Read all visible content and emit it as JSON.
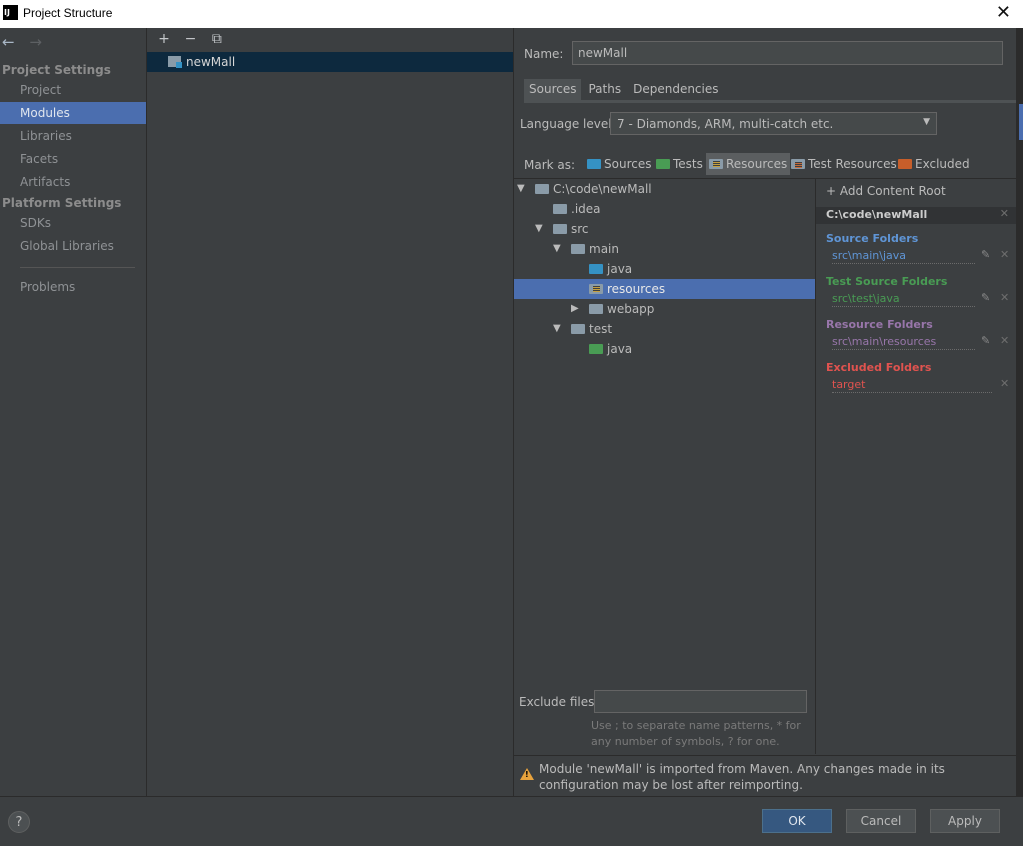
{
  "window": {
    "title": "Project Structure",
    "app_icon_text": "IJ",
    "close_glyph": "✕"
  },
  "nav": {
    "back": "←",
    "forward": "→"
  },
  "sidebar": {
    "project_settings_header": "Project Settings",
    "project_settings_items": [
      {
        "label": "Project"
      },
      {
        "label": "Modules",
        "selected": true
      },
      {
        "label": "Libraries"
      },
      {
        "label": "Facets"
      },
      {
        "label": "Artifacts"
      }
    ],
    "platform_settings_header": "Platform Settings",
    "platform_settings_items": [
      {
        "label": "SDKs"
      },
      {
        "label": "Global Libraries"
      }
    ],
    "problems": "Problems"
  },
  "modules_panel": {
    "toolbar": {
      "add": "+",
      "remove": "−",
      "copy": "⧉"
    },
    "module_name": "newMall"
  },
  "details": {
    "name_label": "Name:",
    "name_value": "newMall",
    "tabs": [
      "Sources",
      "Paths",
      "Dependencies"
    ],
    "selected_tab": "Sources",
    "language_level_label": "Language level:",
    "language_level_value": "7 - Diamonds, ARM, multi-catch etc.",
    "mark_as_label": "Mark as:",
    "mark_as_buttons": [
      "Sources",
      "Tests",
      "Resources",
      "Test Resources",
      "Excluded"
    ],
    "mark_as_selected": "Resources",
    "tree": [
      {
        "label": "C:\\code\\newMall",
        "expanded": true
      },
      {
        "label": ".idea"
      },
      {
        "label": "src",
        "expanded": true
      },
      {
        "label": "main",
        "expanded": true
      },
      {
        "label": "java"
      },
      {
        "label": "resources",
        "selected": true
      },
      {
        "label": "webapp",
        "expanded": false
      },
      {
        "label": "test",
        "expanded": true
      },
      {
        "label": "java"
      }
    ],
    "content_root": {
      "add_label": "+ Add Content Root",
      "root_path": "C:\\code\\newMall",
      "source_folders_title": "Source Folders",
      "source_folders_path": "src\\main\\java",
      "test_source_folders_title": "Test Source Folders",
      "test_source_folders_path": "src\\test\\java",
      "resource_folders_title": "Resource Folders",
      "resource_folders_path": "src\\main\\resources",
      "excluded_folders_title": "Excluded Folders",
      "excluded_folders_path": "target",
      "colors": {
        "source": "#5f95d6",
        "test": "#499c54",
        "resource": "#9876aa",
        "excluded": "#e0534f"
      }
    },
    "exclude_files_label": "Exclude files:",
    "exclude_files_value": "",
    "exclude_files_hint": "Use ; to separate name patterns, * for any number of symbols, ? for one.",
    "warning_text": "Module 'newMall' is imported from Maven. Any changes made in its configuration may be lost after reimporting."
  },
  "footer": {
    "help": "?",
    "ok": "OK",
    "cancel": "Cancel",
    "apply": "Apply"
  }
}
